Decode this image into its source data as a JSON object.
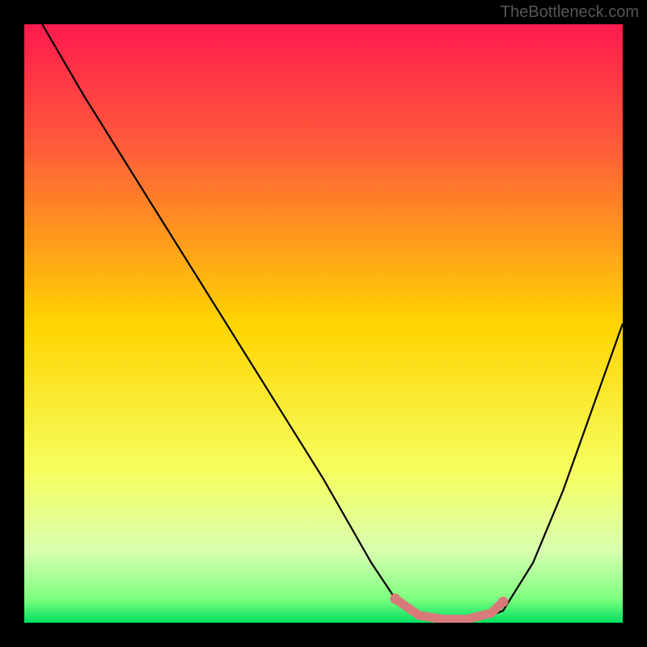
{
  "watermark": "TheBottleneck.com",
  "chart_data": {
    "type": "line",
    "title": "",
    "xlabel": "",
    "ylabel": "",
    "xlim": [
      0,
      100
    ],
    "ylim": [
      0,
      100
    ],
    "gradient_stops": [
      {
        "offset": 0,
        "color": "#ff1a4d"
      },
      {
        "offset": 20,
        "color": "#ff5a3a"
      },
      {
        "offset": 50,
        "color": "#ffd400"
      },
      {
        "offset": 75,
        "color": "#f5ff60"
      },
      {
        "offset": 88,
        "color": "#d8ffb0"
      },
      {
        "offset": 96,
        "color": "#7fff7f"
      },
      {
        "offset": 100,
        "color": "#00e060"
      }
    ],
    "series": [
      {
        "name": "bottleneck-curve",
        "x": [
          3,
          10,
          20,
          30,
          40,
          50,
          58,
          62,
          66,
          72,
          76,
          80,
          85,
          90,
          95,
          100
        ],
        "y": [
          100,
          88,
          72,
          56,
          40,
          24,
          10,
          4,
          1,
          0.5,
          0.5,
          2,
          10,
          22,
          36,
          50
        ]
      }
    ],
    "highlight_segment": {
      "name": "optimal-range",
      "color": "#d97a7a",
      "x": [
        62,
        66,
        70,
        74,
        78,
        80
      ],
      "y": [
        4,
        1.2,
        0.6,
        0.6,
        1.6,
        3.5
      ]
    }
  }
}
